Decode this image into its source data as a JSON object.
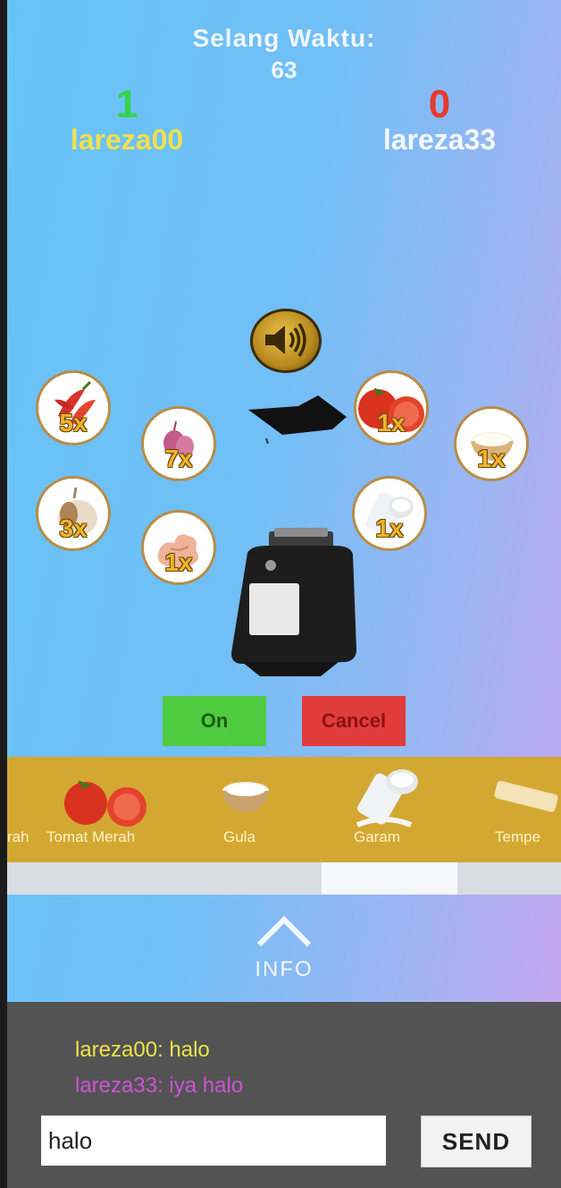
{
  "timer": {
    "label": "Selang Waktu:",
    "value": "63"
  },
  "players": [
    {
      "name": "lareza00",
      "score": "1"
    },
    {
      "name": "lareza33",
      "score": "0"
    }
  ],
  "ingredients": [
    {
      "id": "cabai",
      "icon": "chili-icon",
      "qty": "5x"
    },
    {
      "id": "bawang-merah",
      "icon": "shallot-icon",
      "qty": "7x"
    },
    {
      "id": "bawang-putih",
      "icon": "garlic-icon",
      "qty": "3x"
    },
    {
      "id": "kencur",
      "icon": "ginger-icon",
      "qty": "1x"
    },
    {
      "id": "tomat",
      "icon": "tomato-icon",
      "qty": "1x"
    },
    {
      "id": "gula",
      "icon": "sugar-icon",
      "qty": "1x"
    },
    {
      "id": "garam",
      "icon": "salt-icon",
      "qty": "1x"
    }
  ],
  "buttons": {
    "on": "On",
    "cancel": "Cancel"
  },
  "shelf": [
    {
      "label": "rah",
      "icon": "partial-item-icon"
    },
    {
      "label": "Tomat Merah",
      "icon": "tomato-icon"
    },
    {
      "label": "Gula",
      "icon": "sugar-bowl-icon"
    },
    {
      "label": "Garam",
      "icon": "salt-icon"
    },
    {
      "label": "Tempe",
      "icon": "tempe-icon"
    }
  ],
  "info": {
    "label": "INFO"
  },
  "chat": {
    "messages": [
      {
        "text": "lareza00: halo",
        "color": "#eee34a"
      },
      {
        "text": "lareza33: iya halo",
        "color": "#cf52d8"
      }
    ],
    "input_value": "halo",
    "send_label": "SEND"
  }
}
